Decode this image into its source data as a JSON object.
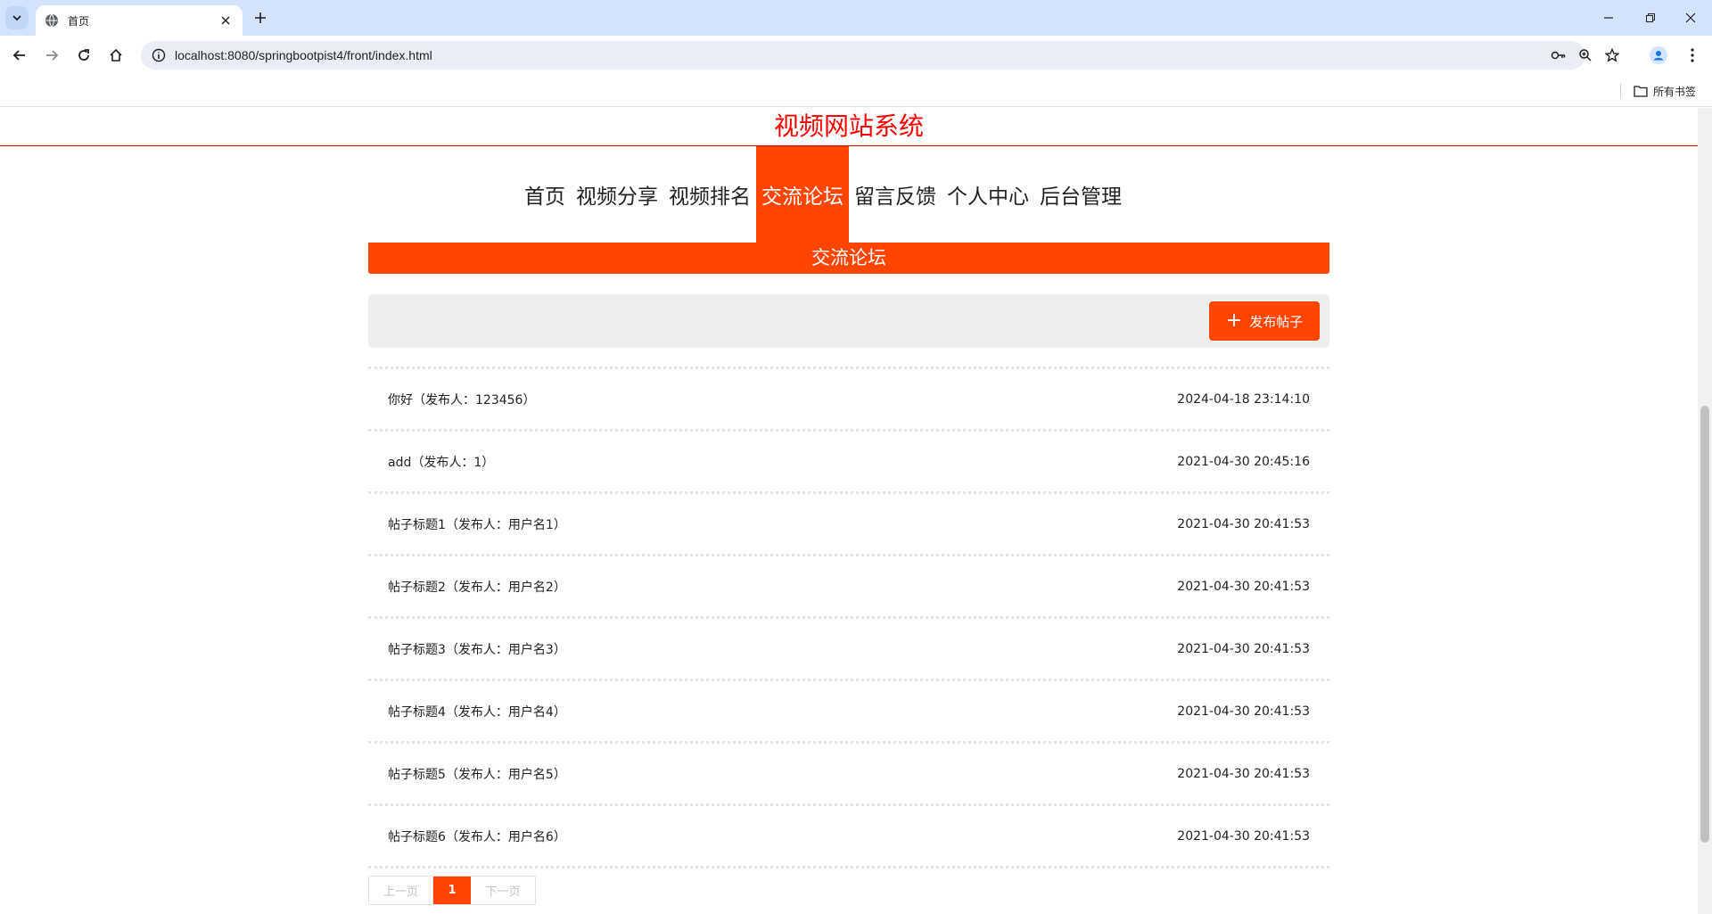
{
  "browser": {
    "tab_title": "首页",
    "url": "localhost:8080/springbootpist4/front/index.html",
    "bookmarks_label": "所有书签"
  },
  "site": {
    "title": "视频网站系统",
    "nav": [
      "首页",
      "视频分享",
      "视频排名",
      "交流论坛",
      "留言反馈",
      "个人中心",
      "后台管理"
    ],
    "active_nav": "交流论坛"
  },
  "forum": {
    "banner": "交流论坛",
    "publish_label": "发布帖子",
    "posts": [
      {
        "title": "你好（发布人：123456）",
        "time": "2024-04-18 23:14:10"
      },
      {
        "title": "add（发布人：1）",
        "time": "2021-04-30 20:45:16"
      },
      {
        "title": "帖子标题1（发布人：用户名1）",
        "time": "2021-04-30 20:41:53"
      },
      {
        "title": "帖子标题2（发布人：用户名2）",
        "time": "2021-04-30 20:41:53"
      },
      {
        "title": "帖子标题3（发布人：用户名3）",
        "time": "2021-04-30 20:41:53"
      },
      {
        "title": "帖子标题4（发布人：用户名4）",
        "time": "2021-04-30 20:41:53"
      },
      {
        "title": "帖子标题5（发布人：用户名5）",
        "time": "2021-04-30 20:41:53"
      },
      {
        "title": "帖子标题6（发布人：用户名6）",
        "time": "2021-04-30 20:41:53"
      }
    ]
  },
  "pager": {
    "prev": "上一页",
    "current": "1",
    "next": "下一页"
  },
  "colors": {
    "accent": "#ff4500",
    "title_red": "#ff0000",
    "chrome_blue": "#d3e3fd"
  }
}
